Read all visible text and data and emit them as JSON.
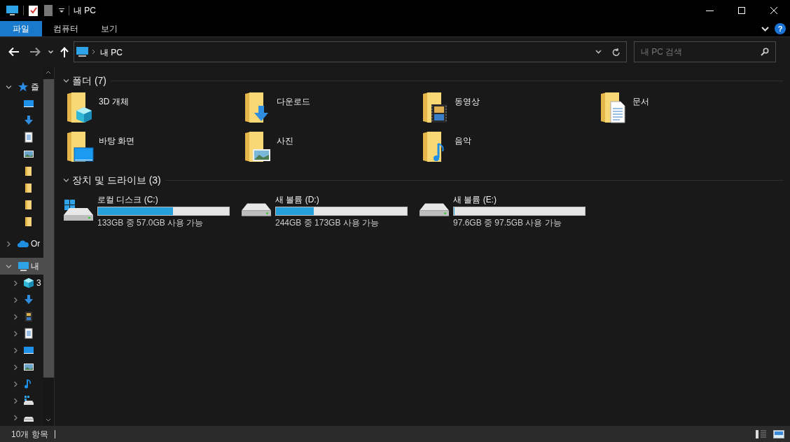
{
  "window": {
    "title": "내 PC"
  },
  "ribbon": {
    "help": "?",
    "tabs": [
      {
        "label": "파일",
        "selected": true
      },
      {
        "label": "컴퓨터",
        "selected": false
      },
      {
        "label": "보기",
        "selected": false
      }
    ]
  },
  "address": {
    "path": [
      "내 PC"
    ]
  },
  "search": {
    "placeholder": "내 PC 검색"
  },
  "navigation": [
    {
      "kind": "star",
      "label": "즐",
      "expanded": true,
      "selected": false,
      "children": [
        {
          "kind": "desktop",
          "selected": false
        },
        {
          "kind": "download",
          "selected": false
        },
        {
          "kind": "document",
          "selected": false
        },
        {
          "kind": "picture",
          "selected": false
        },
        {
          "kind": "folder",
          "selected": false
        },
        {
          "kind": "folder",
          "selected": false
        },
        {
          "kind": "folder",
          "selected": false
        },
        {
          "kind": "folder",
          "selected": false
        }
      ]
    },
    {
      "kind": "cloud",
      "label": "Or",
      "expanded": false,
      "selected": false
    },
    {
      "kind": "pc",
      "label": "내",
      "expanded": true,
      "selected": true,
      "children": [
        {
          "kind": "cube",
          "label": "3",
          "expanded": false,
          "selected": false
        },
        {
          "kind": "download",
          "expanded": false,
          "selected": false
        },
        {
          "kind": "video",
          "expanded": false,
          "selected": false
        },
        {
          "kind": "document",
          "expanded": false,
          "selected": false
        },
        {
          "kind": "desktop",
          "expanded": false,
          "selected": false
        },
        {
          "kind": "picture",
          "expanded": false,
          "selected": false
        },
        {
          "kind": "music",
          "expanded": false,
          "selected": false
        },
        {
          "kind": "drive-win",
          "expanded": false,
          "selected": false
        },
        {
          "kind": "drive",
          "expanded": false,
          "selected": false
        }
      ]
    }
  ],
  "sections": [
    {
      "title": "폴더 (7)",
      "expanded": true,
      "kind": "folders",
      "items": [
        {
          "kind": "cube",
          "label": "3D 개체"
        },
        {
          "kind": "download",
          "label": "다운로드"
        },
        {
          "kind": "video",
          "label": "동영상"
        },
        {
          "kind": "document",
          "label": "문서"
        },
        {
          "kind": "desktop",
          "label": "바탕 화면"
        },
        {
          "kind": "picture",
          "label": "사진"
        },
        {
          "kind": "music",
          "label": "음악"
        }
      ]
    },
    {
      "title": "장치 및 드라이브 (3)",
      "expanded": true,
      "kind": "drives",
      "items": [
        {
          "kind": "drive-win",
          "label": "로컬 디스크 (C:)",
          "level": 0.57,
          "reading": "133GB 중 57.0GB 사용 가능"
        },
        {
          "kind": "drive",
          "label": "새 볼륨 (D:)",
          "level": 0.29,
          "reading": "244GB 중 173GB 사용 가능"
        },
        {
          "kind": "drive",
          "label": "새 볼륨 (E:)",
          "level": 0.001,
          "reading": "97.6GB 중 97.5GB 사용 가능"
        }
      ]
    }
  ],
  "status_bar": {
    "items": "10개 항목"
  }
}
